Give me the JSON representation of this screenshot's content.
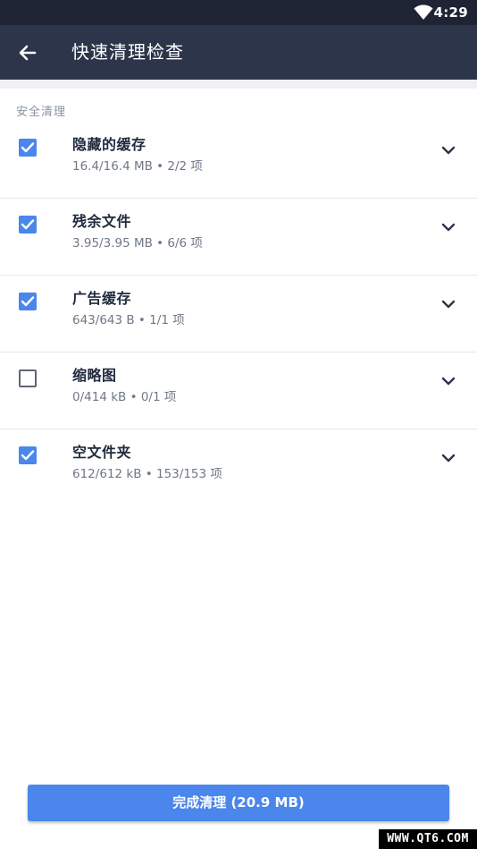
{
  "status_bar": {
    "time": "4:29",
    "icons": [
      "wifi-icon"
    ]
  },
  "app_bar": {
    "back_icon": "arrow-left-icon",
    "title": "快速清理检查"
  },
  "section": {
    "header": "安全清理"
  },
  "items": [
    {
      "name": "隐藏的缓存",
      "detail": "16.4/16.4 MB • 2/2 项",
      "checked": true
    },
    {
      "name": "残余文件",
      "detail": "3.95/3.95 MB • 6/6 项",
      "checked": true
    },
    {
      "name": "广告缓存",
      "detail": "643/643 B • 1/1 项",
      "checked": true
    },
    {
      "name": "缩略图",
      "detail": "0/414 kB • 0/1 项",
      "checked": false
    },
    {
      "name": "空文件夹",
      "detail": "612/612 kB • 153/153 项",
      "checked": true
    }
  ],
  "action": {
    "label": "完成清理 (20.9 MB)"
  },
  "watermark": "WWW.QT6.COM",
  "colors": {
    "status_bar": "#1e2433",
    "app_bar": "#2c3549",
    "accent": "#4a86ec"
  }
}
